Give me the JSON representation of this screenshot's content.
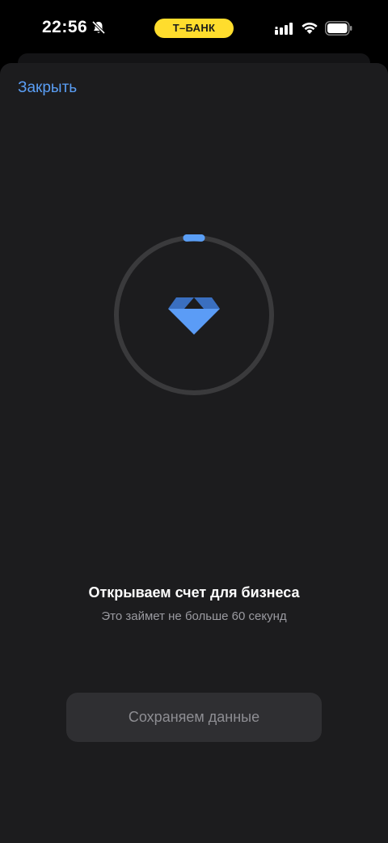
{
  "status_bar": {
    "time": "22:56",
    "carrier": "Т–БАНК",
    "icons": [
      "bell-off-icon",
      "signal-icon",
      "wifi-icon",
      "battery-icon"
    ]
  },
  "header": {
    "close_label": "Закрыть"
  },
  "loader": {
    "icon": "diamond-icon",
    "progress_fraction": 0.03
  },
  "main": {
    "title": "Открываем счет для бизнеса",
    "subtitle": "Это займет не больше 60 секунд"
  },
  "button": {
    "label": "Сохраняем данные"
  },
  "colors": {
    "accent": "#5a9ef5",
    "carrier_pill": "#ffdd2d",
    "sheet_background": "#1c1c1e",
    "ring_track": "#3a3a3c",
    "diamond_light": "#5b9cf6",
    "diamond_dark": "#3a6fc0"
  }
}
